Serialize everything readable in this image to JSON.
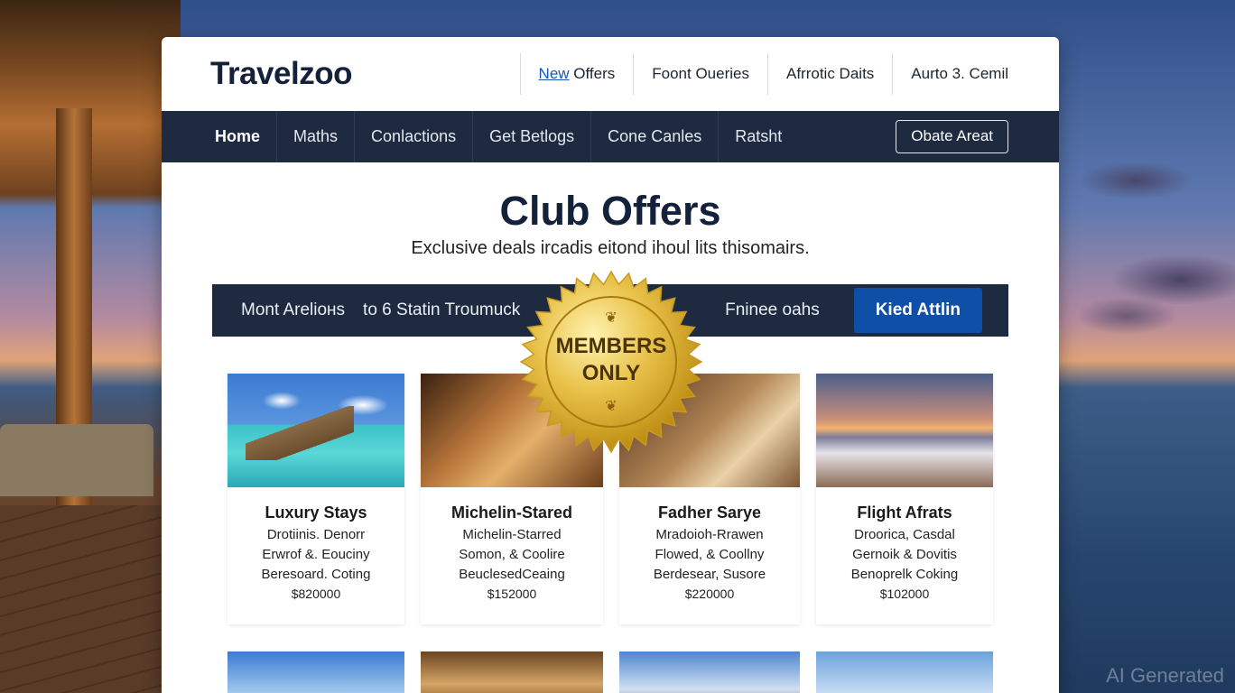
{
  "brand": {
    "name": "Travelzoo"
  },
  "top_links": [
    {
      "underlined": "New",
      "rest": " Offers"
    },
    {
      "underlined": "",
      "rest": "Foont Oueries"
    },
    {
      "underlined": "",
      "rest": "Afrrotic Daits"
    },
    {
      "underlined": "",
      "rest": "Aurto 3. Cemil"
    }
  ],
  "nav": {
    "items": [
      "Home",
      "Maths",
      "Conlactions",
      "Get Betlogs",
      "Cone Canles",
      "Ratsht"
    ],
    "button_label": "Obate Areat"
  },
  "hero": {
    "title": "Club Offers",
    "subtitle": "Exclusive deals ircadis eitond ihoul lits thisomairs."
  },
  "filter": {
    "item1": "Mont Arelioнs",
    "item2": "to 6 Statin Troumuck",
    "item3": "Fninee oahs",
    "button_label": "Kied Attlin"
  },
  "badge": {
    "line1": "MEMBERS",
    "line2": "ONLY"
  },
  "cards": [
    {
      "title": "Luxury Stays",
      "line1": "Drotiinis. Denorr",
      "line2": "Erwrof &. Eouciny",
      "line3": "Beresoard. Coting",
      "price": "$820000",
      "icon": "overwater-villa-image"
    },
    {
      "title": "Michelin-Stared",
      "line1": "Michelin-Starred",
      "line2": "Somon, & Coolire",
      "line3": "BeuclesedCeaing",
      "price": "$152000",
      "icon": "restaurant-image"
    },
    {
      "title": "Fadher Sarye",
      "line1": "Mradoioh-Rrawen",
      "line2": "Flowed, & Coollny",
      "line3": "Berdesear, Susore",
      "price": "$220000",
      "icon": "hotel-lounge-image"
    },
    {
      "title": "Flight Afrats",
      "line1": "Droorica, Casdal",
      "line2": "Gernoik & Dovitis",
      "line3": "Benoprelk Coking",
      "price": "$102000",
      "icon": "sunset-suite-image"
    }
  ],
  "watermark": "AI Generated"
}
